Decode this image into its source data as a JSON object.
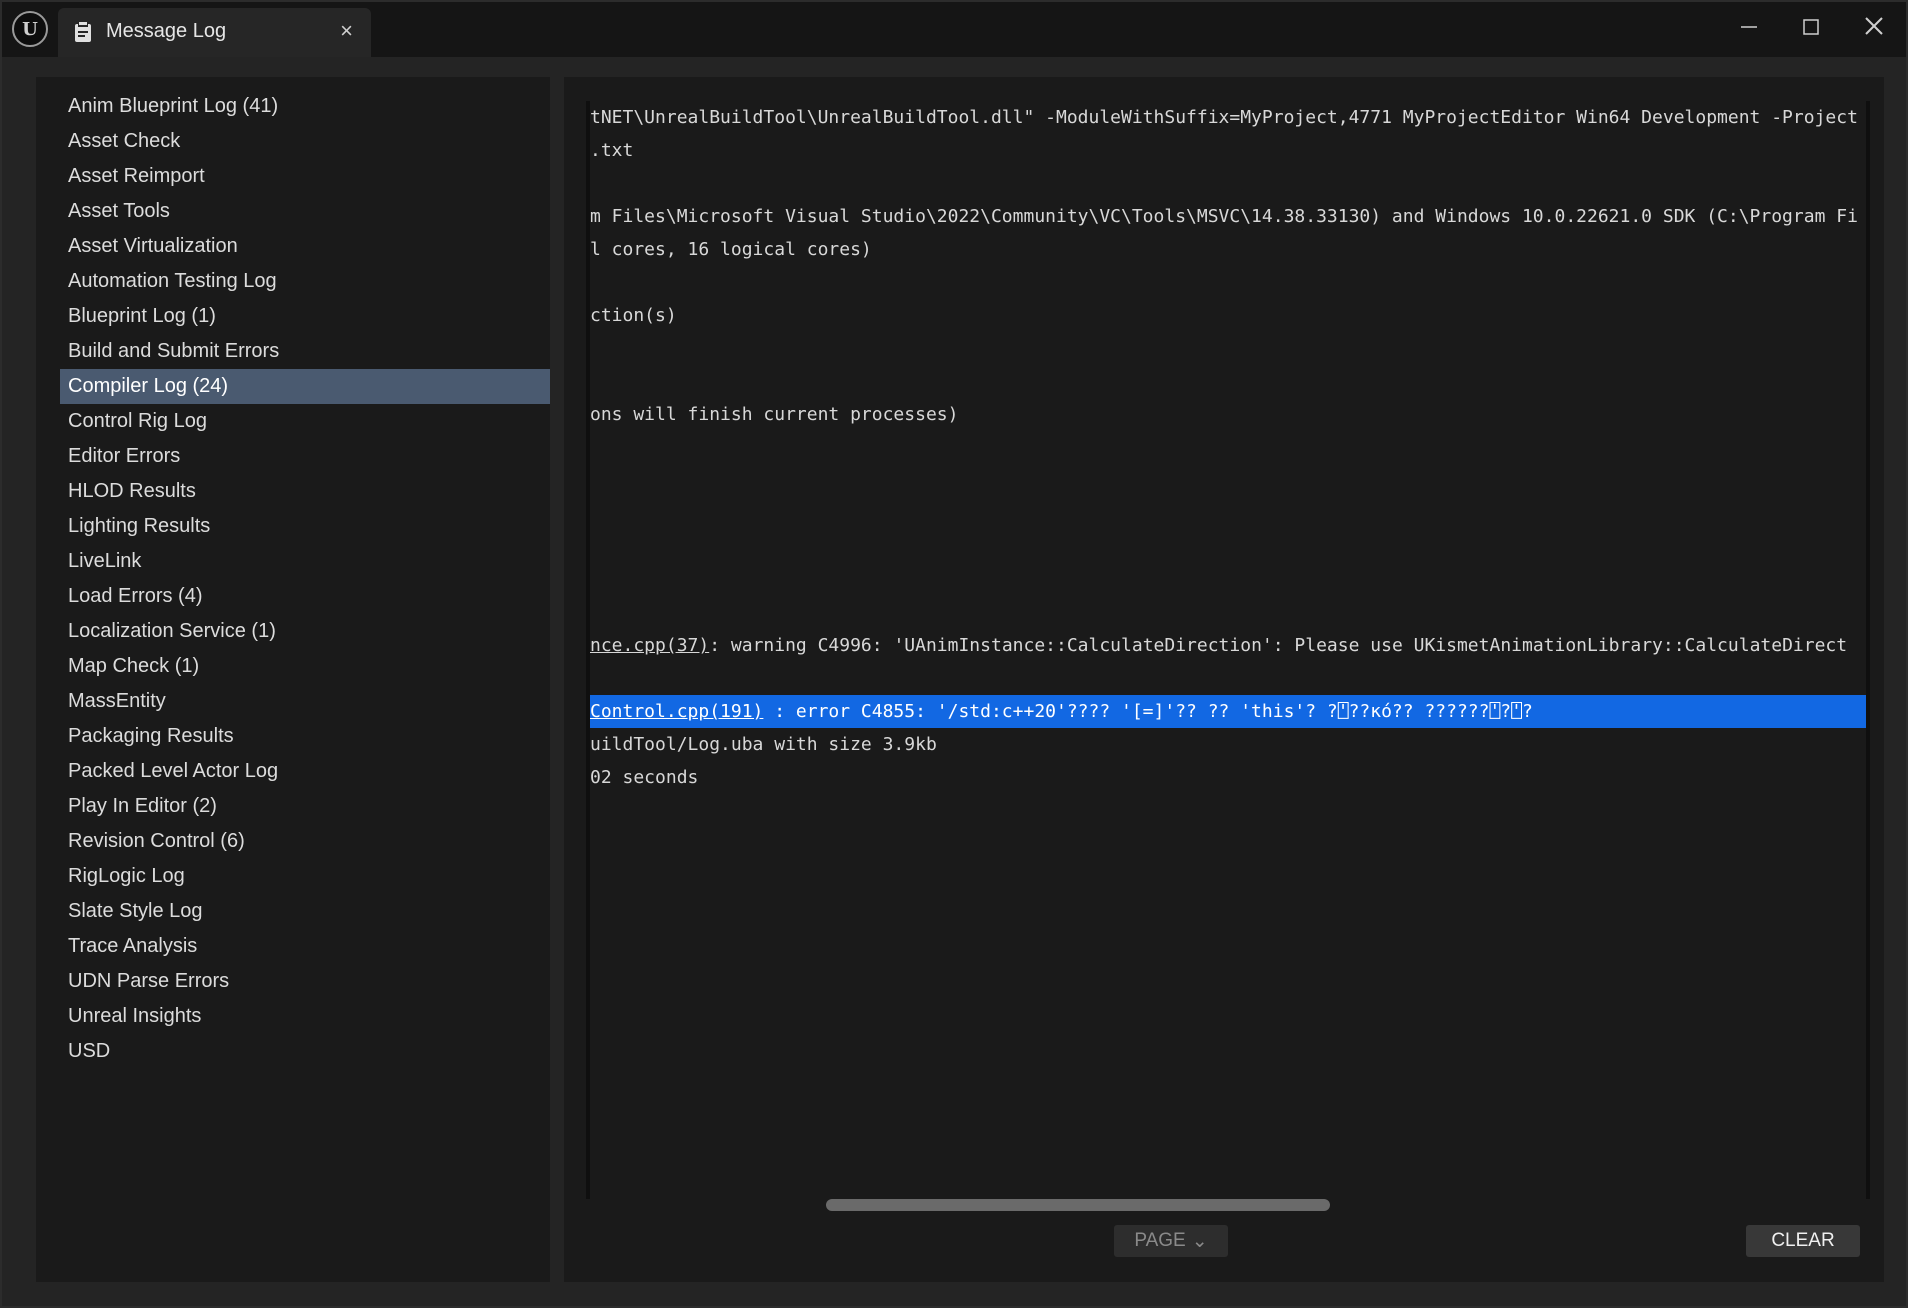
{
  "window": {
    "tab_title": "Message Log",
    "tab_close": "×",
    "logo_letter": "U"
  },
  "categories": [
    {
      "label": "Anim Blueprint Log (41)"
    },
    {
      "label": "Asset Check"
    },
    {
      "label": "Asset Reimport"
    },
    {
      "label": "Asset Tools"
    },
    {
      "label": "Asset Virtualization"
    },
    {
      "label": "Automation Testing Log"
    },
    {
      "label": "Blueprint Log (1)"
    },
    {
      "label": "Build and Submit Errors"
    },
    {
      "label": "Compiler Log (24)",
      "selected": true
    },
    {
      "label": "Control Rig Log"
    },
    {
      "label": "Editor Errors"
    },
    {
      "label": "HLOD Results"
    },
    {
      "label": "Lighting Results"
    },
    {
      "label": "LiveLink"
    },
    {
      "label": "Load Errors (4)"
    },
    {
      "label": "Localization Service (1)"
    },
    {
      "label": "Map Check (1)"
    },
    {
      "label": "MassEntity"
    },
    {
      "label": "Packaging Results"
    },
    {
      "label": "Packed Level Actor Log"
    },
    {
      "label": "Play In Editor (2)"
    },
    {
      "label": "Revision Control (6)"
    },
    {
      "label": "RigLogic Log"
    },
    {
      "label": "Slate Style Log"
    },
    {
      "label": "Trace Analysis"
    },
    {
      "label": "UDN Parse Errors"
    },
    {
      "label": "Unreal Insights"
    },
    {
      "label": "USD"
    }
  ],
  "log_lines": [
    {
      "text": "tNET\\UnrealBuildTool\\UnrealBuildTool.dll\" -ModuleWithSuffix=MyProject,4771 MyProjectEditor Win64 Development -Project"
    },
    {
      "text": ".txt"
    },
    {
      "text": ""
    },
    {
      "text": "m Files\\Microsoft Visual Studio\\2022\\Community\\VC\\Tools\\MSVC\\14.38.33130) and Windows 10.0.22621.0 SDK (C:\\Program Fi"
    },
    {
      "text": "l cores, 16 logical cores)"
    },
    {
      "text": ""
    },
    {
      "text": "ction(s)"
    },
    {
      "text": ""
    },
    {
      "text": ""
    },
    {
      "text": "ons will finish current processes)"
    },
    {
      "text": ""
    },
    {
      "text": ""
    },
    {
      "text": ""
    },
    {
      "text": ""
    },
    {
      "text": ""
    },
    {
      "text": ""
    },
    {
      "text": "",
      "link": "nce.cpp(37)",
      "text_after": ": warning C4996: 'UAnimInstance::CalculateDirection': Please use UKismetAnimationLibrary::CalculateDirect"
    },
    {
      "text": ""
    },
    {
      "text": "",
      "link": "Control.cpp(191)",
      "text_after": " : error C4855: '/std:c++20'???? '[=]'?? ?? 'this'? ?⍞??ĸó?? ??????⍞?⍞?",
      "selected": true
    },
    {
      "text": "uildTool/Log.uba with size 3.9kb"
    },
    {
      "text": "02 seconds"
    }
  ],
  "footer": {
    "page_label": "PAGE",
    "page_chevron": "⌄",
    "clear_label": "CLEAR"
  },
  "colors": {
    "selection_blue": "#1268e3",
    "sidebar_selected": "#4a5a70",
    "background": "#1a1a1a"
  }
}
